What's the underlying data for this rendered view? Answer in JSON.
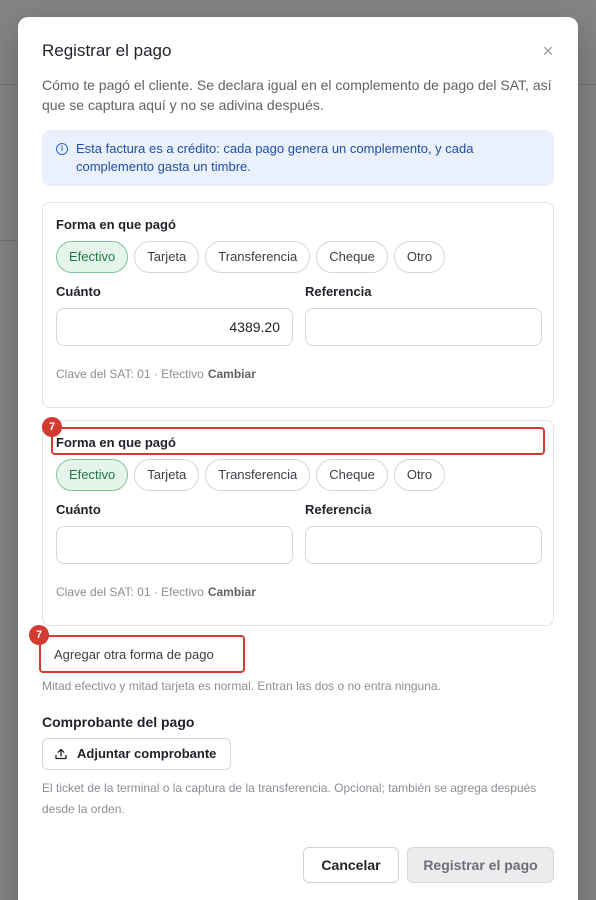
{
  "modal": {
    "title": "Registrar el pago",
    "close_symbol": "×",
    "description": "Cómo te pagó el cliente. Se declara igual en el complemento de pago del SAT, así que se captura aquí y no se adivina después.",
    "info": "Esta factura es a crédito: cada pago genera un complemento, y cada complemento gasta un timbre."
  },
  "payments": [
    {
      "label": "Forma en que pagó",
      "methods": [
        "Efectivo",
        "Tarjeta",
        "Transferencia",
        "Cheque",
        "Otro"
      ],
      "selected": "Efectivo",
      "amount_label": "Cuánto",
      "amount": "4389.20",
      "reference_label": "Referencia",
      "reference": "",
      "sat_text": "Clave del SAT: 01 · Efectivo",
      "change_label": "Cambiar"
    },
    {
      "label": "Forma en que pagó",
      "methods": [
        "Efectivo",
        "Tarjeta",
        "Transferencia",
        "Cheque",
        "Otro"
      ],
      "selected": "Efectivo",
      "amount_label": "Cuánto",
      "amount": "",
      "reference_label": "Referencia",
      "reference": "",
      "sat_text": "Clave del SAT: 01 · Efectivo",
      "change_label": "Cambiar"
    }
  ],
  "annotations": {
    "badge1": "7",
    "badge2": "7"
  },
  "add_method": "Agregar otra forma de pago",
  "add_hint": "Mitad efectivo y mitad tarjeta es normal. Entran las dos o no entra ninguna.",
  "receipt": {
    "title": "Comprobante del pago",
    "button": "Adjuntar comprobante",
    "hint": "El ticket de la terminal o la captura de la transferencia. Opcional; también se agrega después desde la orden."
  },
  "footer": {
    "cancel": "Cancelar",
    "submit": "Registrar el pago"
  },
  "colors": {
    "accent_green": "#1d7a45",
    "annotation_red": "#d23a32",
    "info_blue": "#1f4fa3"
  }
}
